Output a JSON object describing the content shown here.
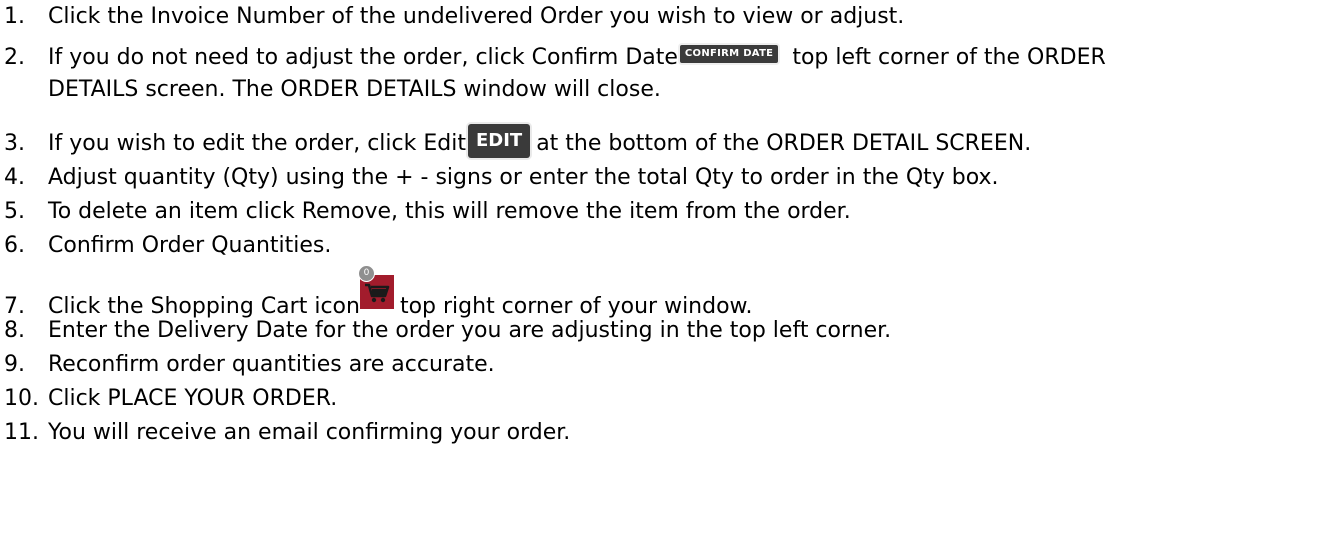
{
  "steps": [
    {
      "number": "1.",
      "text": "Click the Invoice Number of the undelivered Order you wish to view or adjust."
    },
    {
      "number": "2.",
      "text_before": "If you do not need to adjust the order, click Confirm Date",
      "text_after": "top left corner of the ORDER",
      "continuation": "DETAILS screen.  The ORDER DETAILS window will close."
    },
    {
      "number": "3.",
      "text_before": "If you wish to edit the order, click Edit",
      "text_after": "at the bottom of the ORDER DETAIL SCREEN."
    },
    {
      "number": "4.",
      "text": "Adjust quantity (Qty) using the + - signs or enter the total Qty to order in the Qty box."
    },
    {
      "number": "5.",
      "text": "To delete an item click Remove, this will remove the item from the order."
    },
    {
      "number": "6.",
      "text": "Confirm Order Quantities."
    },
    {
      "number": "7.",
      "text_before": "Click the Shopping Cart icon",
      "text_after": "top right corner of your window."
    },
    {
      "number": "8.",
      "text": "Enter the Delivery Date for the order you are adjusting in the top left corner."
    },
    {
      "number": "9.",
      "text": "Reconfirm order quantities are accurate."
    },
    {
      "number": "10.",
      "text": "Click PLACE YOUR ORDER."
    },
    {
      "number": "11.",
      "text": "You will receive an email confirming your order."
    }
  ],
  "inline_buttons": {
    "confirm_date_label": "CONFIRM DATE",
    "edit_label": "EDIT",
    "cart_badge_count": "0"
  },
  "colors": {
    "button_bg": "#3b3b3b",
    "cart_bg": "#a21c2c",
    "badge_bg": "#8f8f8f"
  },
  "icons": {
    "cart": "shopping-cart-icon"
  }
}
